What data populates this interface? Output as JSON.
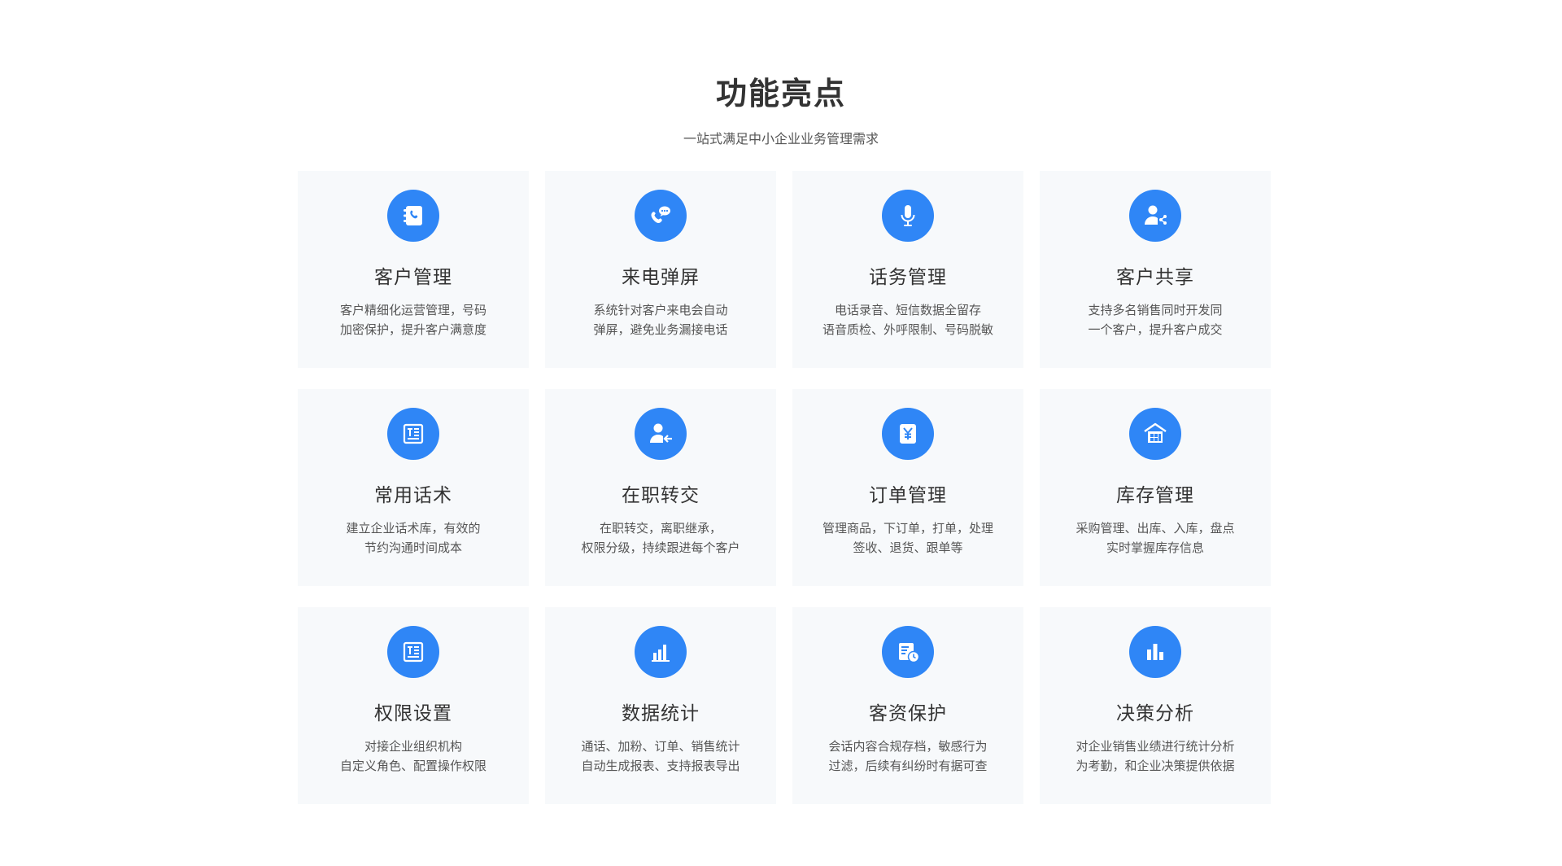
{
  "header": {
    "title": "功能亮点",
    "subtitle": "一站式满足中小企业业务管理需求"
  },
  "accent_color": "#2f86f6",
  "cards": [
    {
      "icon": "phone-book-icon",
      "title": "客户管理",
      "lines": [
        "客户精细化运营管理，号码",
        "加密保护，提升客户满意度"
      ]
    },
    {
      "icon": "phone-chat-icon",
      "title": "来电弹屏",
      "lines": [
        "系统针对客户来电会自动",
        "弹屏，避免业务漏接电话"
      ]
    },
    {
      "icon": "microphone-icon",
      "title": "话务管理",
      "lines": [
        "电话录音、短信数据全留存",
        "语音质检、外呼限制、号码脱敏"
      ]
    },
    {
      "icon": "user-share-icon",
      "title": "客户共享",
      "lines": [
        "支持多名销售同时开发同",
        "一个客户，提升客户成交"
      ]
    },
    {
      "icon": "script-document-icon",
      "title": "常用话术",
      "lines": [
        "建立企业话术库，有效的",
        "节约沟通时间成本"
      ]
    },
    {
      "icon": "user-transfer-icon",
      "title": "在职转交",
      "lines": [
        "在职转交，离职继承，",
        "权限分级，持续跟进每个客户"
      ]
    },
    {
      "icon": "yen-order-icon",
      "title": "订单管理",
      "lines": [
        "管理商品，下订单，打单，处理",
        "签收、退货、跟单等"
      ]
    },
    {
      "icon": "warehouse-icon",
      "title": "库存管理",
      "lines": [
        "采购管理、出库、入库，盘点",
        "实时掌握库存信息"
      ]
    },
    {
      "icon": "permission-document-icon",
      "title": "权限设置",
      "lines": [
        "对接企业组织机构",
        "自定义角色、配置操作权限"
      ]
    },
    {
      "icon": "bar-chart-icon",
      "title": "数据统计",
      "lines": [
        "通话、加粉、订单、销售统计",
        "自动生成报表、支持报表导出"
      ]
    },
    {
      "icon": "archive-clock-icon",
      "title": "客资保护",
      "lines": [
        "会话内容合规存档，敏感行为",
        "过滤，后续有纠纷时有据可查"
      ]
    },
    {
      "icon": "analysis-chart-icon",
      "title": "决策分析",
      "lines": [
        "对企业销售业绩进行统计分析",
        "为考勤，和企业决策提供依据"
      ]
    }
  ]
}
